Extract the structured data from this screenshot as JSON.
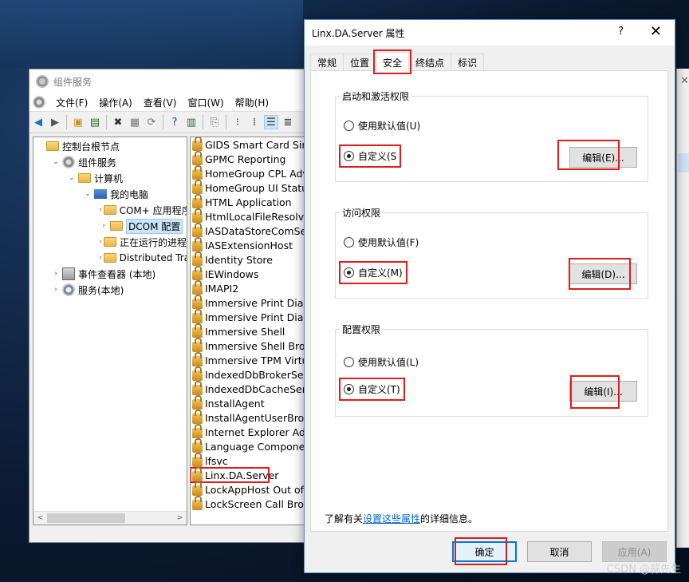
{
  "mmc": {
    "title": "组件服务",
    "menu": [
      "文件(F)",
      "操作(A)",
      "查看(V)",
      "窗口(W)",
      "帮助(H)"
    ],
    "tree": [
      {
        "label": "控制台根节点",
        "indent": 0,
        "twisty": "",
        "icon": "folder"
      },
      {
        "label": "组件服务",
        "indent": 1,
        "twisty": "⌄",
        "icon": "component"
      },
      {
        "label": "计算机",
        "indent": 2,
        "twisty": "⌄",
        "icon": "folder"
      },
      {
        "label": "我的电脑",
        "indent": 3,
        "twisty": "⌄",
        "icon": "computer"
      },
      {
        "label": "COM+ 应用程序",
        "indent": 4,
        "twisty": "›",
        "icon": "folder"
      },
      {
        "label": "DCOM 配置",
        "indent": 4,
        "twisty": "›",
        "icon": "folder",
        "selected": true
      },
      {
        "label": "正在运行的进程",
        "indent": 4,
        "twisty": "›",
        "icon": "folder"
      },
      {
        "label": "Distributed Transaction Coordinator",
        "indent": 4,
        "twisty": "›",
        "icon": "folder"
      },
      {
        "label": "事件查看器 (本地)",
        "indent": 1,
        "twisty": "›",
        "icon": "eventlog"
      },
      {
        "label": "服务(本地)",
        "indent": 1,
        "twisty": "›",
        "icon": "services"
      }
    ],
    "list": [
      "GIDS Smart Card Simulator",
      "GPMC Reporting",
      "HomeGroup CPL Advanced Settings",
      "HomeGroup UI Status",
      "HTML Application",
      "HtmlLocalFileResolver",
      "IASDataStoreComServer",
      "IASExtensionHost",
      "Identity Store",
      "IEWindows",
      "IMAPI2",
      "Immersive Print Dialog",
      "Immersive Print Dialog",
      "Immersive Shell",
      "Immersive Shell Broker",
      "Immersive TPM Virtual Smart Card",
      "IndexedDbBrokerServer",
      "IndexedDbCacheServer",
      "InstallAgent",
      "InstallAgentUserBroker",
      "Internet Explorer Add-on Installer",
      "Language Component Installer",
      "lfsvc",
      "Linx.DA.Server",
      "LockAppHost Out of Proc Server",
      "LockScreen Call Broker"
    ],
    "highlighted_item": "Linx.DA.Server"
  },
  "dialog": {
    "title": "Linx.DA.Server 属性",
    "help": "?",
    "close": "✕",
    "tabs": [
      "常规",
      "位置",
      "安全",
      "终结点",
      "标识"
    ],
    "active_tab": "安全",
    "groups": [
      {
        "title": "启动和激活权限",
        "default_label": "使用默认值(U)",
        "custom_label": "自定义(S",
        "edit_label": "编辑(E)..."
      },
      {
        "title": "访问权限",
        "default_label": "使用默认值(F)",
        "custom_label": "自定义(M)",
        "edit_label": "编辑(D)..."
      },
      {
        "title": "配置权限",
        "default_label": "使用默认值(L)",
        "custom_label": "自定义(T)",
        "edit_label": "编辑(I)..."
      }
    ],
    "info_prefix": "了解有关",
    "info_link": "设置这些属性",
    "info_suffix": "的详细信息。",
    "ok": "确定",
    "cancel": "取消",
    "apply": "应用(A)"
  },
  "watermark": "CSDN @蒜先生",
  "colors": {
    "highlight": "#e01b1b",
    "accent": "#0078d7",
    "link": "#0066cc"
  }
}
